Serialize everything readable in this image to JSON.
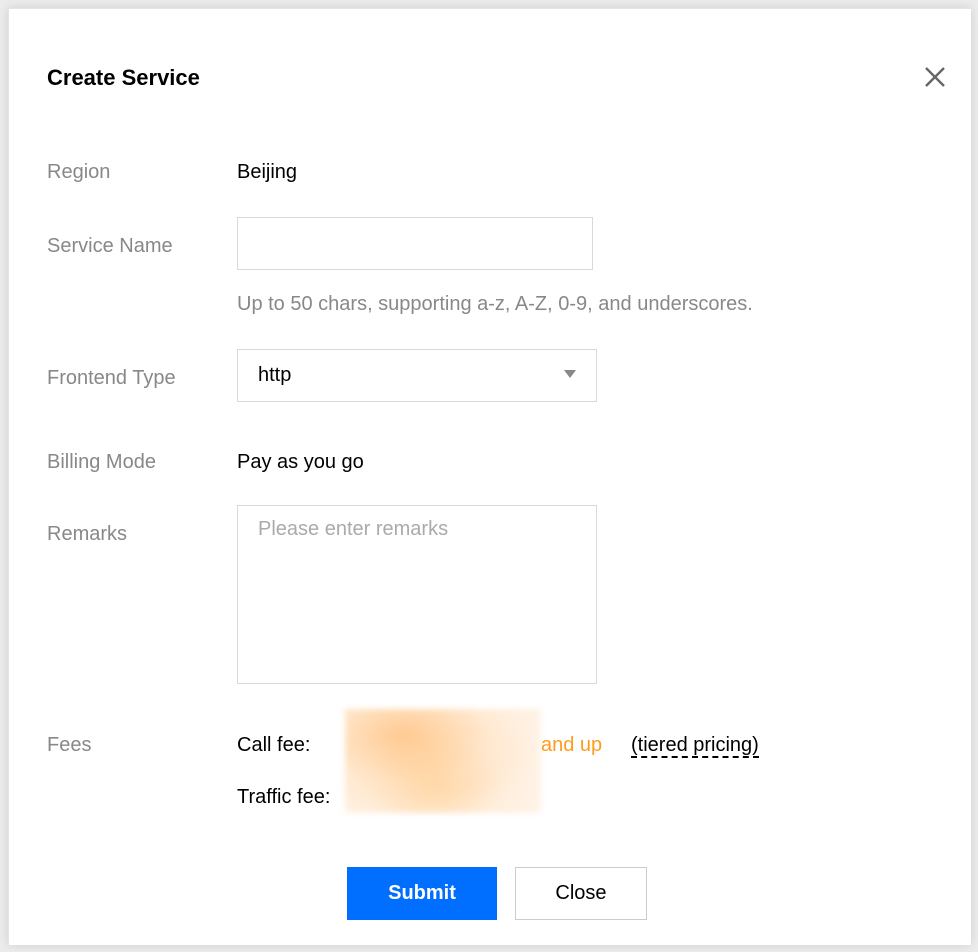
{
  "dialog": {
    "title": "Create Service"
  },
  "form": {
    "region": {
      "label": "Region",
      "value": "Beijing"
    },
    "service_name": {
      "label": "Service Name",
      "value": "",
      "placeholder": "",
      "hint": "Up to 50 chars, supporting a-z, A-Z, 0-9, and underscores."
    },
    "frontend_type": {
      "label": "Frontend Type",
      "selected": "http"
    },
    "billing_mode": {
      "label": "Billing Mode",
      "value": "Pay as you go"
    },
    "remarks": {
      "label": "Remarks",
      "value": "",
      "placeholder": "Please enter remarks"
    },
    "fees": {
      "label": "Fees",
      "call_fee_label": "Call fee:",
      "call_fee_suffix": "and up",
      "tiered_link": "(tiered pricing)",
      "traffic_fee_label": "Traffic fee:"
    }
  },
  "buttons": {
    "submit": "Submit",
    "close": "Close"
  },
  "colors": {
    "primary": "#006eff",
    "accent_orange": "#ff9c19",
    "label_gray": "#888888"
  }
}
